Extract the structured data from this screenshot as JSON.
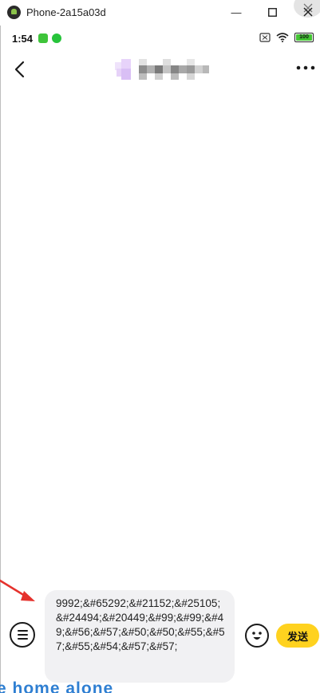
{
  "window": {
    "title": "Phone-2a15a03d",
    "minimize_glyph": "—",
    "maximize_glyph": "☐",
    "close_glyph": "✕"
  },
  "statusbar": {
    "time": "1:54",
    "notif_icons": [
      "app-notif-icon",
      "wechat-icon"
    ],
    "battery_level": "100"
  },
  "header": {
    "back_icon": "chevron-left-icon",
    "more_icon": "more-dots-icon"
  },
  "composer": {
    "message_text": "9992;&#65292;&#21152;&#25105;&#24494;&#20449;&#99;&#99;&#49;&#56;&#57;&#50;&#50;&#55;&#57;&#55;&#54;&#57;&#57;",
    "send_label": "发送",
    "accent": "#ffd21f"
  },
  "overlay": {
    "watermark": "e home alone"
  },
  "colors": {
    "annotation_arrow": "#e5322d",
    "watermark": "#2f7fd2"
  }
}
